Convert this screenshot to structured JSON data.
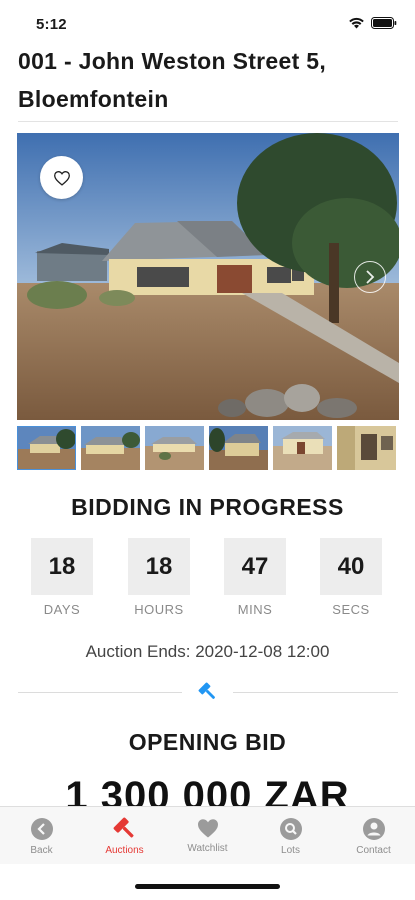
{
  "status_bar": {
    "time": "5:12"
  },
  "listing": {
    "title": "001 - John Weston Street 5, Bloemfontein"
  },
  "gallery": {
    "thumbnail_count": 6
  },
  "auction": {
    "status_heading": "BIDDING IN PROGRESS",
    "countdown": [
      {
        "value": "18",
        "label": "DAYS"
      },
      {
        "value": "18",
        "label": "HOURS"
      },
      {
        "value": "47",
        "label": "MINS"
      },
      {
        "value": "40",
        "label": "SECS"
      }
    ],
    "ends_text": "Auction Ends: 2020-12-08 12:00",
    "opening_bid_heading": "OPENING BID",
    "opening_bid_amount": "1 300 000 ZAR"
  },
  "tab_bar": {
    "items": [
      {
        "label": "Back",
        "icon": "back-arrow-icon",
        "active": false
      },
      {
        "label": "Auctions",
        "icon": "gavel-icon",
        "active": true
      },
      {
        "label": "Watchlist",
        "icon": "heart-icon",
        "active": false
      },
      {
        "label": "Lots",
        "icon": "search-icon",
        "active": false
      },
      {
        "label": "Contact",
        "icon": "person-icon",
        "active": false
      }
    ]
  },
  "colors": {
    "accent_active": "#e53935",
    "gavel_blue": "#2196f3",
    "tab_inactive": "#9b9b9b"
  }
}
